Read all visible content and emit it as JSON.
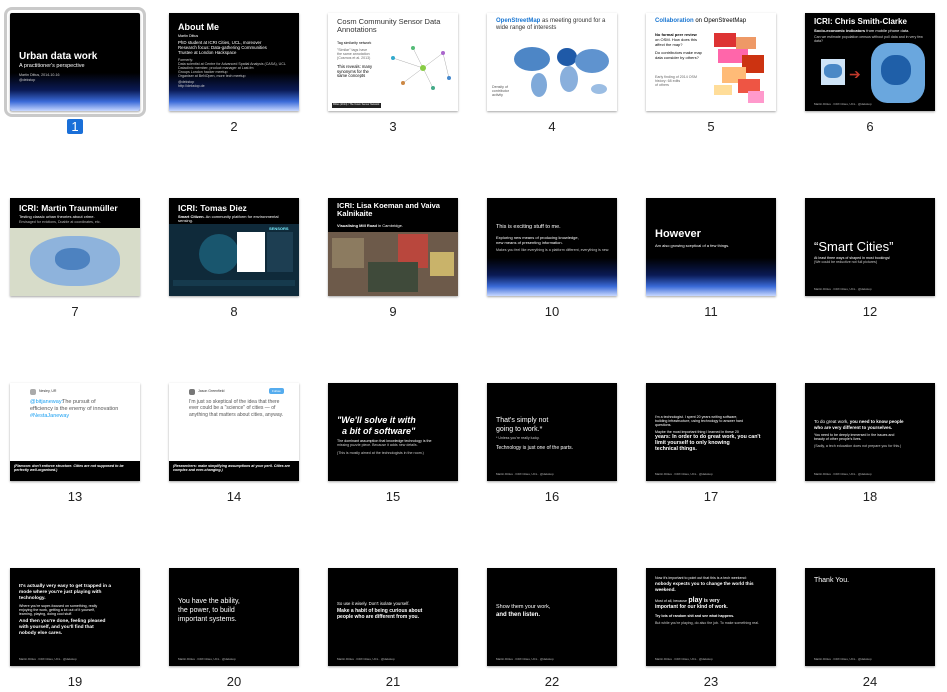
{
  "slides": [
    {
      "num": "1",
      "title": "Urban data work",
      "subtitle": "A practitioner's perspective",
      "meta": "Martin Dittus, 2014-10-16",
      "handle": "@dekstop"
    },
    {
      "num": "2",
      "title": "About Me",
      "name": "Martin Dittus",
      "line1": "PhD student at ICRI Cities, UCL, moreover",
      "line2": "Research focus: Data-gathering Communities",
      "line3": "Trustee at London Hackspace",
      "formerly": "Formerly:",
      "f1": "Data scientist at Centre for Advanced Spatial Analysis (CASA), UCL",
      "f2": "Dataclinic member, product manager at Last.fm",
      "f3": "Groups London hacker meetup",
      "f4": "Organiser at BeNOpen, more tech meetup",
      "contact1": "@dekstop",
      "contact2": "http://dekstop.de"
    },
    {
      "num": "3",
      "title": "Cosm Community Sensor Data Annotations",
      "sub": "Tag similarity network",
      "note1": "\"Similar\" tags have",
      "note2": "the same annotation",
      "note3": "(Cosmos et al. 2013)",
      "reveal": "This reveals: many synonyms for the same concepts",
      "credit": "Dittus (2014) / The Cosm Sensor Network"
    },
    {
      "num": "4",
      "title_bold": "OpenStreetMap",
      "title_rest": "as meeting ground for a wide range of interests",
      "legend1": "Density of",
      "legend2": "contributor",
      "legend3": "activity"
    },
    {
      "num": "5",
      "title_bold": "Collaboration",
      "title_rest": "on OpenStreetMap",
      "q0": "No formal peer review",
      "q1": "on OSM. How does this",
      "q2": "affect the map?",
      "q3": "Do contributors make map",
      "q4": "data consider by others?",
      "cite1": "Early finding of 2014 OSM",
      "cite2": "history: 68 edits",
      "cite3": "of others"
    },
    {
      "num": "6",
      "title": "ICRI: Chris Smith-Clarke",
      "sub_bold": "Socio-economic indicators",
      "sub_rest": "from mobile phone data.",
      "sub2": "Can we estimate population census without poll data and in very few data?",
      "footer": "Martin Dittus · ICRI Cities, UCL · @dekstop"
    },
    {
      "num": "7",
      "title": "ICRI: Martin Traunmüller",
      "sub": "Testing classic urban theories about crime.",
      "sub2": "Envisaged for evictions, Doable at coordinates, etc."
    },
    {
      "num": "8",
      "title": "ICRI: Tomas Diez",
      "sub_bold": "Smart Citizen.",
      "sub_rest": "An community platform for environmental sensing.",
      "brand": "SENSORS"
    },
    {
      "num": "9",
      "title": "ICRI: Lisa Koeman and Vaiva Kalnikaite",
      "sub_bold": "Visualising Mill Road",
      "sub_rest": "in Cambridge."
    },
    {
      "num": "10",
      "line1": "This is exciting stuff to me.",
      "line2": "Exploring new means of producing knowledge,",
      "line3": "new means of presenting information.",
      "line4": "Makes you feel like everything is a platform different, everything is new."
    },
    {
      "num": "11",
      "title": "However",
      "sub": "Am also growing sceptical of a few things."
    },
    {
      "num": "12",
      "title": "“Smart Cities”",
      "sub1": "At least three ways of shaped in most bookings!",
      "sub2": "(We could be reductive not full pictures)",
      "footer": "Martin Dittus · ICRI Cities, UCL · @dekstop"
    },
    {
      "num": "13",
      "name": "Nesley, UR",
      "tag": "@bitjaneway:",
      "tweet1": "The pursuit of",
      "tweet2": "efficiency is the enemy of innovation",
      "tweet3": "#NestaJaneway",
      "caption": "(Flamcon: don't enforce structure. Cities are not supposed to be perfectly well-organised.)"
    },
    {
      "num": "14",
      "name": "Jason Greenfield",
      "button": "Follow",
      "tweet": "I'm just so skeptical of the idea that there ever could be a \"science\" of cities — of anything that matters about cities, anyway.",
      "caption": "(Researchers: make simplifying assumptions at your peril. Cities are complex and ever-changing.)"
    },
    {
      "num": "15",
      "quote1": "\"We'll solve it with",
      "quote2": "a bit of software\"",
      "line1": "The dominant assumption that knowledge technology is the",
      "line2": "missing puzzle piece. Because it adds new details.",
      "line3": "(This is mostly aimed at the technologists in the room.)"
    },
    {
      "num": "16",
      "line1": "That's simply not",
      "line2": "going to work.*",
      "note": "* Unless you're really lucky.",
      "line3": "Technology is just one of the parts.",
      "footer": "Martin Dittus · ICRI Cities, UCL · @dekstop"
    },
    {
      "num": "17",
      "line1": "I'm a technologist. I spent 20 years writing software,",
      "line2": "building infrastructure, using technology to answer hard",
      "line3": "questions.",
      "line4": "Maybe the most important thing I learned in these 20",
      "line5": "years: In order to do great work, you can't",
      "line6": "limit yourself to only knowing",
      "line7": "technical things.",
      "footer": "Martin Dittus · ICRI Cities, UCL · @dekstop"
    },
    {
      "num": "18",
      "line1a": "To do great work,",
      "line1b": "you need to know people",
      "line2": "who are very different to yourselves.",
      "line3": "You need to be deeply immersed in the issues and",
      "line4": "beauty of other people's lives.",
      "line5": "(Sadly, a tech education does not prepare you for this.)",
      "footer": "Martin Dittus · ICRI Cities, UCL · @dekstop"
    },
    {
      "num": "19",
      "line1": "It's actually very easy to get trapped in a",
      "line2": "mode where you're just playing with",
      "line3": "technology.",
      "line4": "Where you're super-focused on something, really",
      "line5": "enjoying the work, getting a lot out of it yourself,",
      "line6": "learning, playing, doing cool stuff.",
      "line7": "And then you're done, feeling pleased",
      "line8": "with yourself, and you'll find that",
      "line9": "nobody else cares.",
      "footer": "Martin Dittus · ICRI Cities, UCL · @dekstop"
    },
    {
      "num": "20",
      "line1": "You have the ability,",
      "line2": "the power, to build",
      "line3": "important systems.",
      "footer": "Martin Dittus · ICRI Cities, UCL · @dekstop"
    },
    {
      "num": "21",
      "line1": "So use it wisely. Don't isolate yourself.",
      "line2": "Make a habit of being curious about",
      "line3": "people who are different from you.",
      "footer": "Martin Dittus · ICRI Cities, UCL · @dekstop"
    },
    {
      "num": "22",
      "line1": "Show them your work,",
      "line2": "and then listen.",
      "footer": "Martin Dittus · ICRI Cities, UCL · @dekstop"
    },
    {
      "num": "23",
      "line1": "Now it's important to point out that this is a tech weekend:",
      "line2": "nobody expects you to change the world this",
      "line3": "weekend.",
      "line4a": "Most of all, because",
      "line4b": "play",
      "line4c": "is very",
      "line5": "important for our kind of work.",
      "line6": "Try lots of random shit and see what happens.",
      "line7": "But while you're playing, do also the job. To make something real.",
      "footer": "Martin Dittus · ICRI Cities, UCL · @dekstop"
    },
    {
      "num": "24",
      "title": "Thank You.",
      "footer": "Martin Dittus · ICRI Cities, UCL · @dekstop"
    }
  ]
}
